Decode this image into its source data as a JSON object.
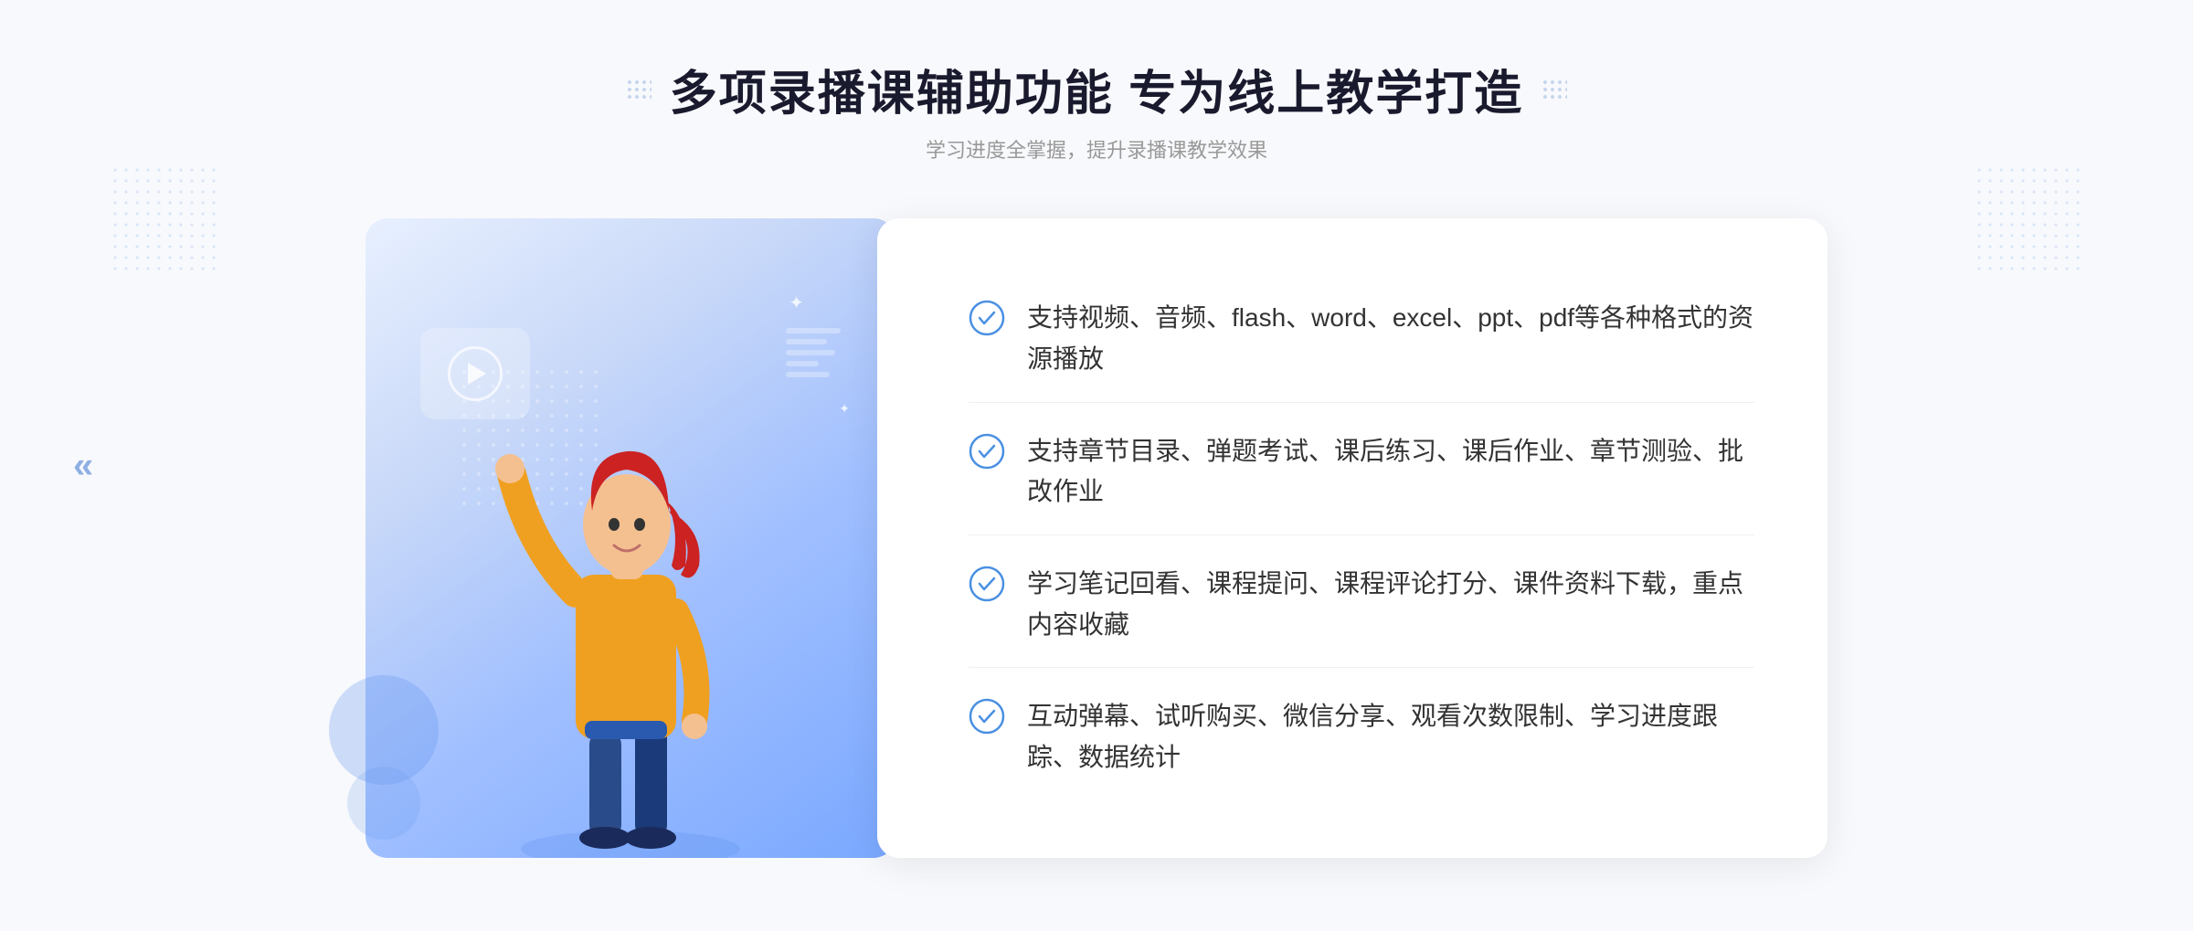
{
  "header": {
    "title": "多项录播课辅助功能 专为线上教学打造",
    "subtitle": "学习进度全掌握，提升录播课教学效果"
  },
  "features": [
    {
      "id": "feature-1",
      "text": "支持视频、音频、flash、word、excel、ppt、pdf等各种格式的资源播放"
    },
    {
      "id": "feature-2",
      "text": "支持章节目录、弹题考试、课后练习、课后作业、章节测验、批改作业"
    },
    {
      "id": "feature-3",
      "text": "学习笔记回看、课程提问、课程评论打分、课件资料下载，重点内容收藏"
    },
    {
      "id": "feature-4",
      "text": "互动弹幕、试听购买、微信分享、观看次数限制、学习进度跟踪、数据统计"
    }
  ],
  "colors": {
    "primary_blue": "#4a90e2",
    "dark_blue": "#2060c0",
    "light_blue": "#e8f0ff",
    "text_dark": "#1a1a2e",
    "text_gray": "#999999",
    "text_body": "#333333",
    "check_color": "#4a90e2"
  },
  "icons": {
    "play": "▶",
    "chevron_left": "«",
    "check_circle": "✓"
  }
}
